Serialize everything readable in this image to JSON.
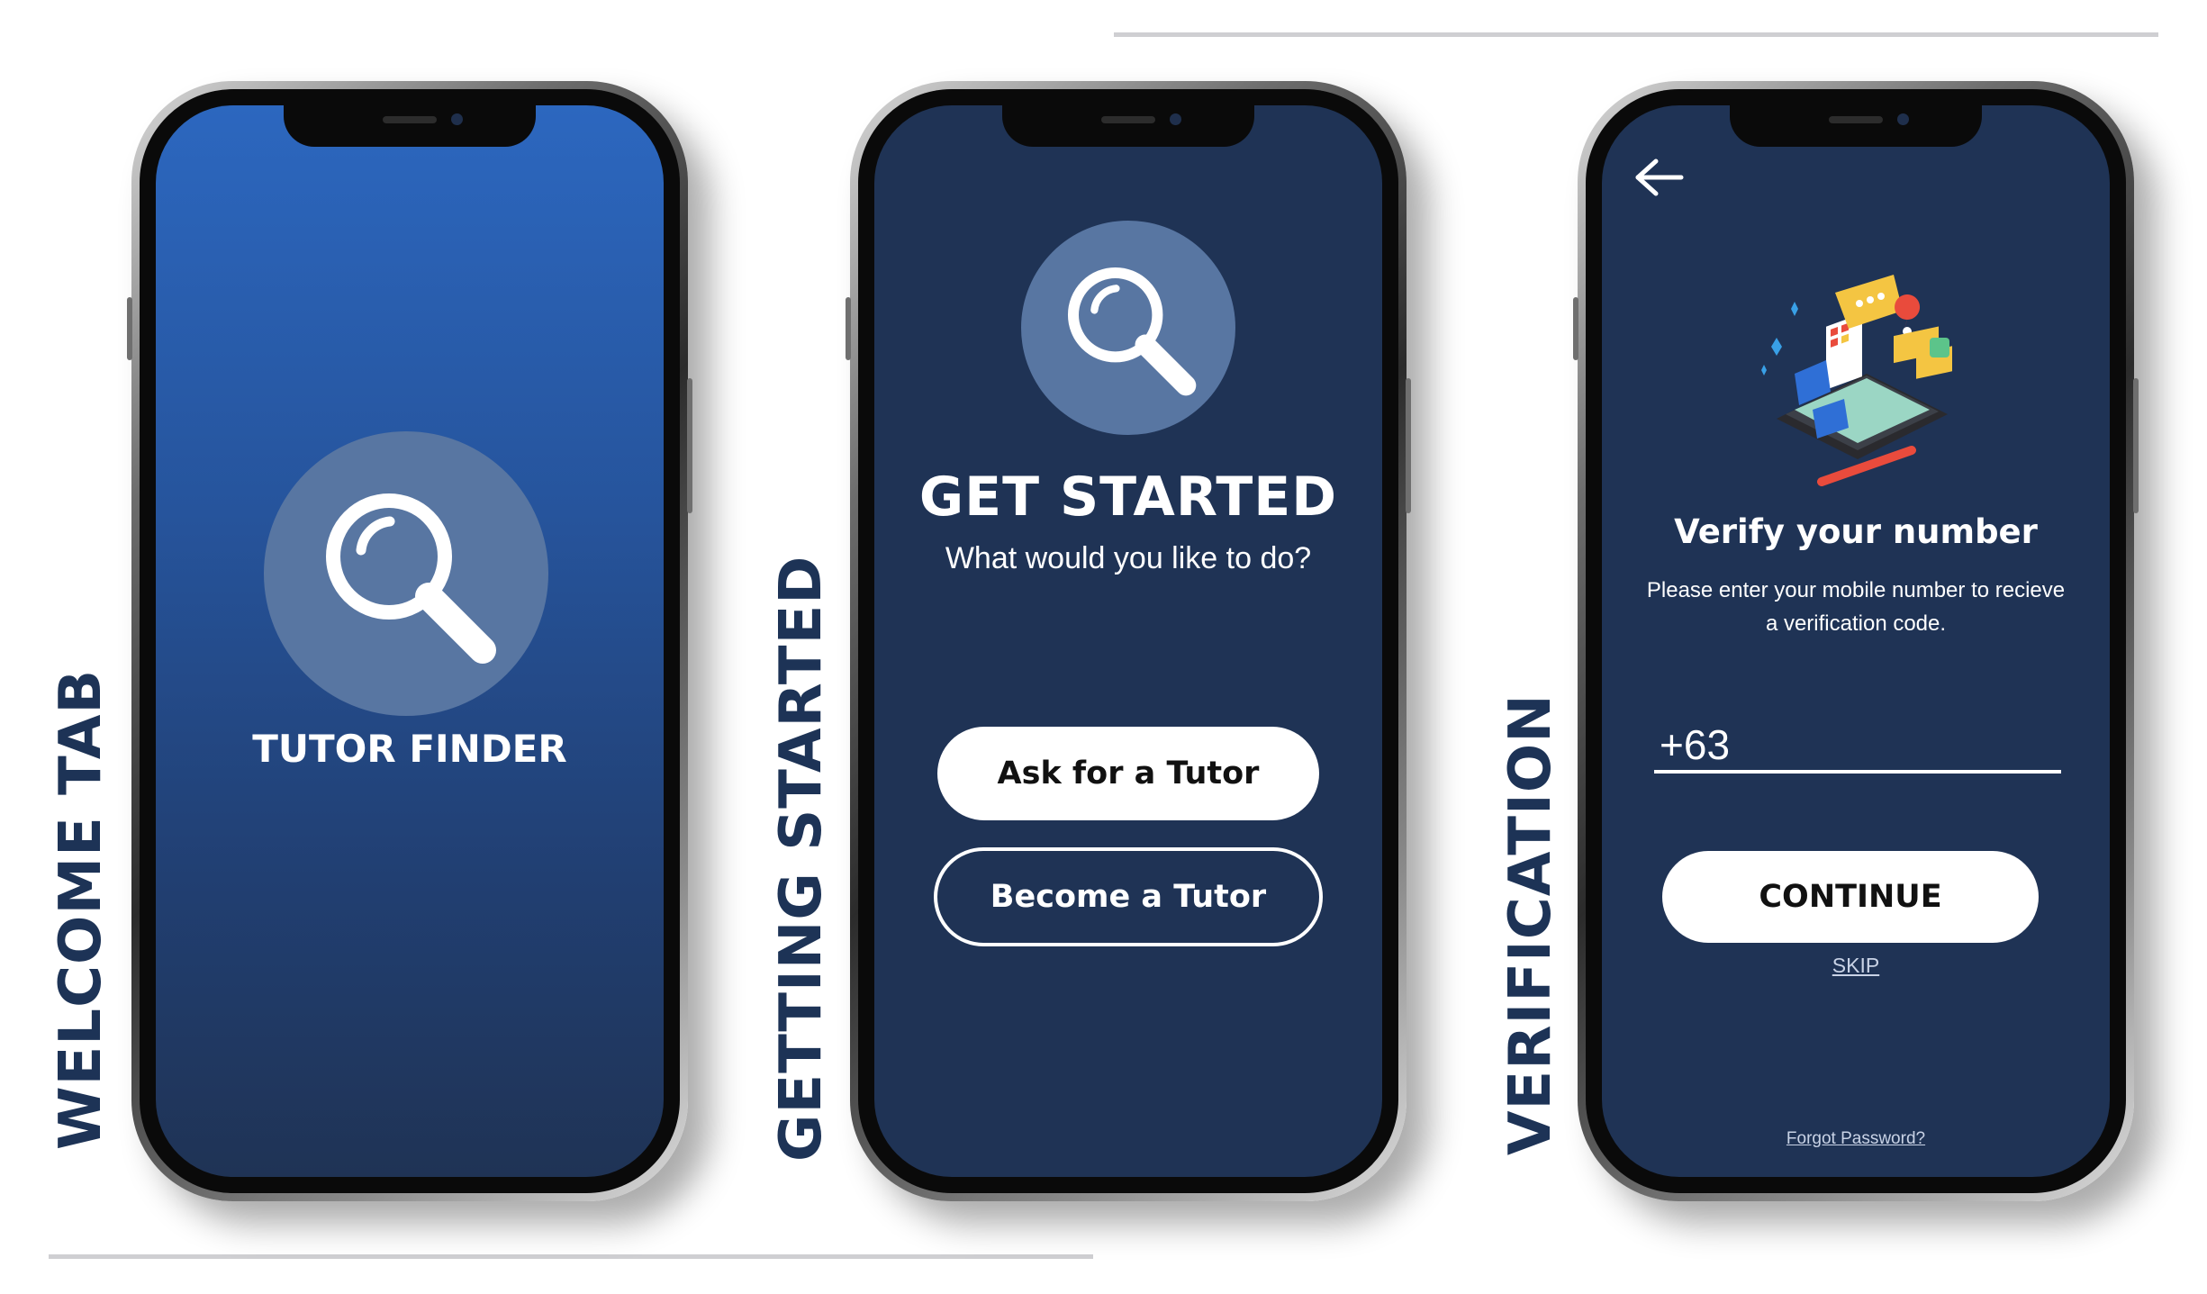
{
  "labels": {
    "welcome": "WELCOME TAB",
    "getting_started": "GETTING STARTED",
    "verification": "VERIFICATION"
  },
  "welcome": {
    "icon": "magnifier-icon",
    "title": "TUTOR FINDER"
  },
  "get_started": {
    "icon": "magnifier-icon",
    "title": "GET STARTED",
    "subtitle": "What would you like to do?",
    "ask_button": "Ask for a Tutor",
    "become_button": "Become a Tutor"
  },
  "verification": {
    "back_icon": "arrow-left-icon",
    "illustration": "mobile-apps-illustration",
    "title": "Verify your number",
    "description_line1": "Please enter your mobile number to recieve",
    "description_line2": "a verification code.",
    "phone_value": "+63",
    "continue_button": "CONTINUE",
    "skip_link": "SKIP",
    "forgot_link": "Forgot Password?"
  },
  "colors": {
    "navy": "#1f3355",
    "blue_top": "#2c67bf",
    "circle": "#5876a2",
    "label": "#1d3356"
  }
}
